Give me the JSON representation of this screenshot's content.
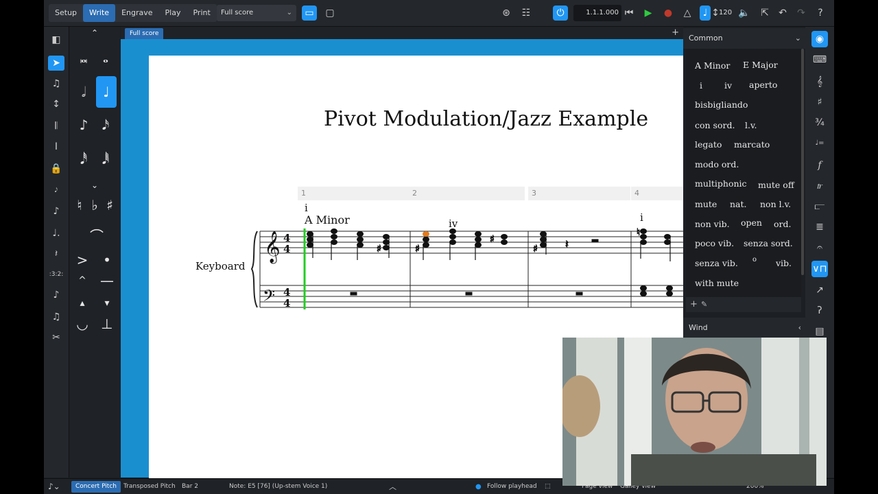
{
  "toolbar": {
    "modes": [
      "Setup",
      "Write",
      "Engrave",
      "Play",
      "Print"
    ],
    "active_mode": "Write",
    "layout": "Full score",
    "time": "1.1.1.000",
    "tempo": "120"
  },
  "score": {
    "tab": "Full score",
    "title": "Pivot Modulation/Jazz Example",
    "bars": [
      "1",
      "2",
      "3",
      "4"
    ],
    "instrument": "Keyboard",
    "annotations": {
      "roman_1": "i",
      "chord_1": "A Minor",
      "roman_2": "iv",
      "roman_4": "i"
    }
  },
  "panel": {
    "section": "Common",
    "terms": [
      "A Minor",
      "E Major",
      "i",
      "iv",
      "aperto",
      "bisbigliando",
      "con sord.",
      "l.v.",
      "legato",
      "marcato",
      "modo ord.",
      "multiphonic",
      "mute off",
      "mute",
      "nat.",
      "non l.v.",
      "non vib.",
      "open",
      "ord.",
      "poco vib.",
      "senza sord.",
      "senza vib.",
      "o",
      "vib.",
      "with mute"
    ],
    "next_section": "Wind"
  },
  "status": {
    "concert": "Concert Pitch",
    "transposed": "Transposed Pitch",
    "bar": "Bar 2",
    "note": "Note: E5 [76] (Up-stem Voice 1)",
    "follow": "Follow playhead",
    "page_view": "Page view",
    "galley_view": "Galley view",
    "zoom": "200%"
  },
  "colors": {
    "accent": "#2196f3",
    "mode_active": "#2b6cb2",
    "playhead": "#22cc22",
    "selected_note": "#e07a1f"
  }
}
